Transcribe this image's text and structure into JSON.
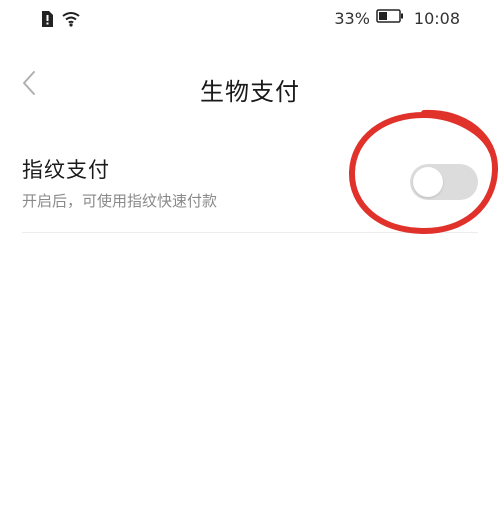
{
  "status_bar": {
    "battery_percent": "33%",
    "time": "10:08",
    "icons": [
      "sim-alert-icon",
      "wifi-icon",
      "battery-icon"
    ]
  },
  "header": {
    "back_icon": "chevron-left-icon",
    "title": "生物支付"
  },
  "settings": {
    "fingerprint_pay": {
      "title": "指纹支付",
      "description": "开启后，可使用指纹快速付款",
      "enabled": false
    }
  },
  "colors": {
    "background": "#ffffff",
    "toggle_off": "#dcdcdc",
    "annotation": "#e0322b",
    "secondary_text": "#8a8a8a"
  }
}
